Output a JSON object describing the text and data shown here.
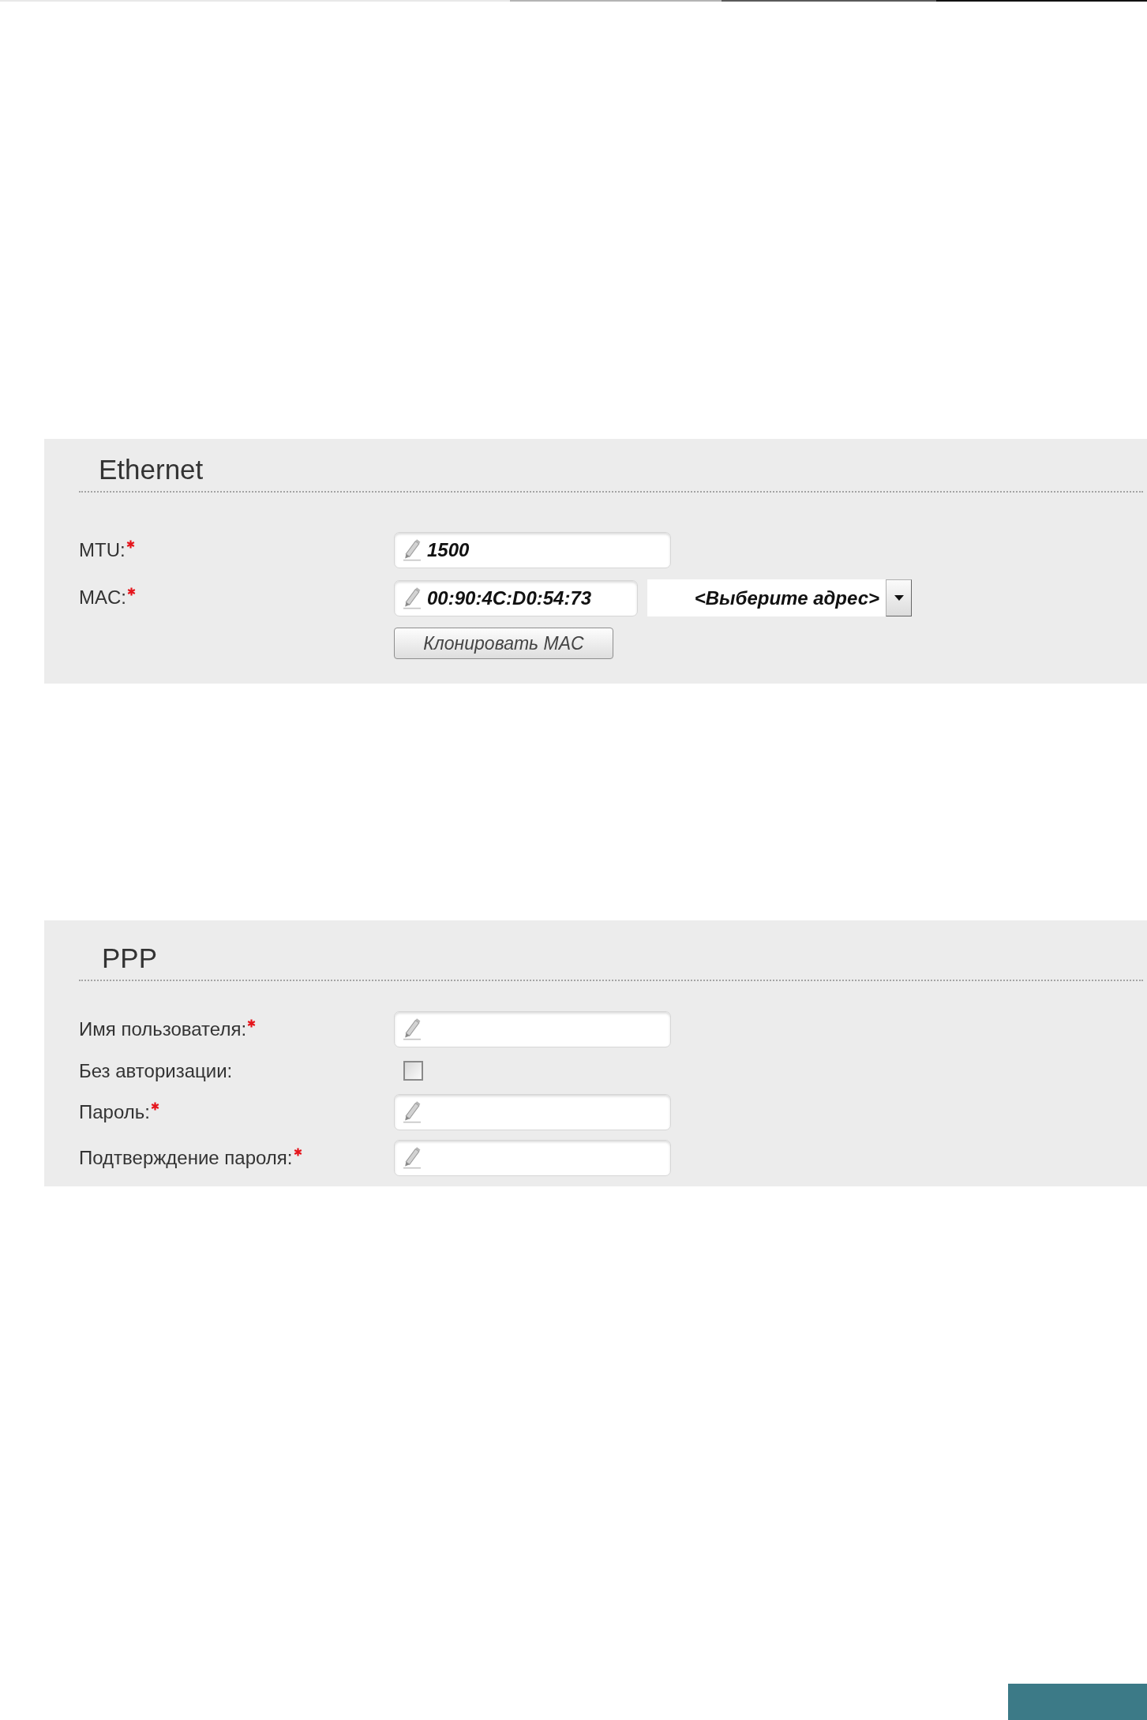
{
  "ethernet": {
    "title": "Ethernet",
    "fields": [
      {
        "kind": "input",
        "label": "MTU:",
        "required": true,
        "value": "1500"
      },
      {
        "kind": "input",
        "label": "MAC:",
        "required": true,
        "value": "00:90:4C:D0:54:73",
        "select": {
          "value": "<Выберите адрес>"
        },
        "button": "Клонировать MAC"
      }
    ]
  },
  "ppp": {
    "title": "PPP",
    "fields": [
      {
        "kind": "input",
        "label": "Имя пользователя:",
        "required": true
      },
      {
        "kind": "checkbox",
        "label": "Без авторизации:",
        "required": false,
        "checked": false
      },
      {
        "kind": "input",
        "label": "Пароль:",
        "required": true
      },
      {
        "kind": "input",
        "label": "Подтверждение пароля:",
        "required": true
      }
    ]
  }
}
